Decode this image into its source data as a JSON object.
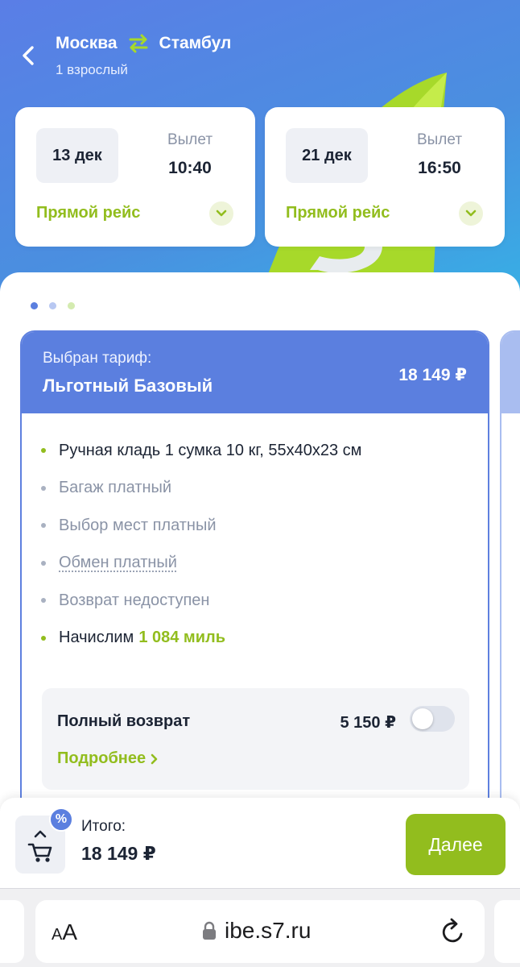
{
  "header": {
    "origin": "Москва",
    "destination": "Стамбул",
    "passengers": "1 взрослый"
  },
  "legs": [
    {
      "date": "13 дек",
      "departure_label": "Вылет",
      "departure_time": "10:40",
      "type": "Прямой рейс"
    },
    {
      "date": "21 дек",
      "departure_label": "Вылет",
      "departure_time": "16:50",
      "type": "Прямой рейс"
    }
  ],
  "carousel": {
    "count": 3,
    "active_index": 0
  },
  "tariff": {
    "chosen_label": "Выбран тариф:",
    "name": "Льготный Базовый",
    "price": "18 149 ₽",
    "features": [
      {
        "text": "Ручная кладь 1 сумка 10 кг, 55х40х23 см",
        "included": true
      },
      {
        "text": "Багаж платный",
        "included": false
      },
      {
        "text": "Выбор мест платный",
        "included": false
      },
      {
        "text": "Обмен платный",
        "included": false
      },
      {
        "text": "Возврат недоступен",
        "included": false
      }
    ],
    "miles_prefix": "Начислим",
    "miles_value": "1 084 миль"
  },
  "refund_option": {
    "title": "Полный возврат",
    "price": "5 150 ₽",
    "enabled": false,
    "more_label": "Подробнее"
  },
  "footer": {
    "discount_badge": "%",
    "total_label": "Итого:",
    "total_value": "18 149 ₽",
    "next_label": "Далее"
  },
  "browser": {
    "text_size_small": "A",
    "text_size_large": "A",
    "url": "ibe.s7.ru"
  },
  "colors": {
    "brand_green": "#92bd1e",
    "brand_blue": "#5b7fdf"
  }
}
